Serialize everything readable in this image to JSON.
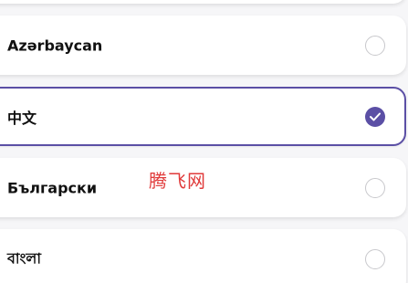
{
  "languages": [
    {
      "label": "",
      "selected": false
    },
    {
      "label": "Azərbaycan",
      "selected": false
    },
    {
      "label": "中文",
      "selected": true
    },
    {
      "label": "Български",
      "selected": false
    },
    {
      "label": "বাংলা",
      "selected": false
    }
  ],
  "colors": {
    "accent": "#5b4fa5",
    "radio_border": "#c8c8cc",
    "card_bg": "#ffffff",
    "page_bg": "#f6f6f8",
    "watermark": "#e03a3a"
  },
  "icons": {
    "selected_radio": "check-icon"
  },
  "watermark": "腾飞网"
}
